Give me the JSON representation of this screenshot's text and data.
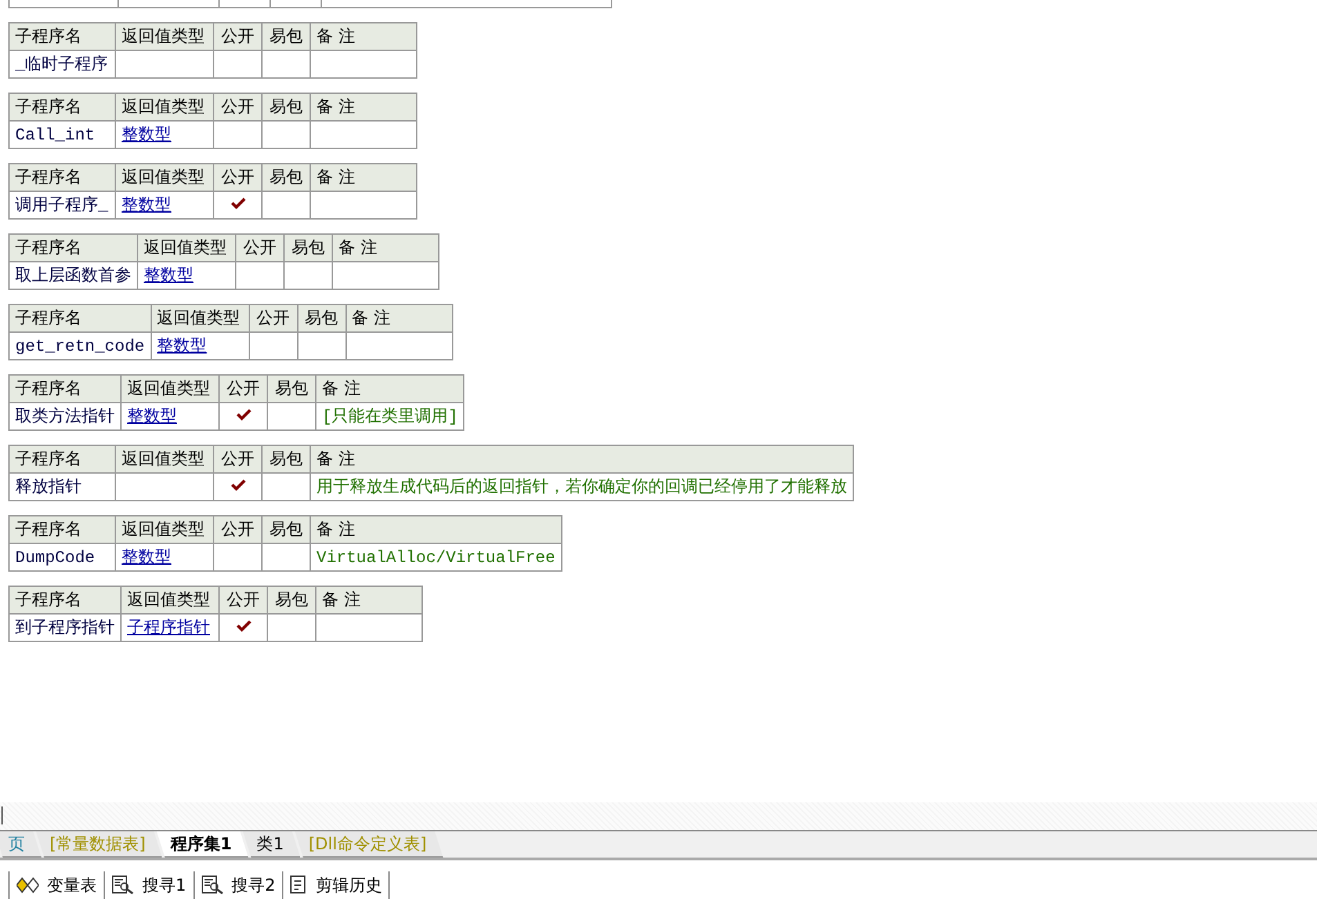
{
  "tables": [
    {
      "columns": [
        "子程序名",
        "返回值类型",
        "公开",
        "易包",
        "备 注"
      ],
      "row": {
        "name": "_临时子程序",
        "public": false
      }
    },
    {
      "columns": [
        "子程序名",
        "返回值类型",
        "公开",
        "易包",
        "备 注"
      ],
      "row": {
        "name": "Call_int",
        "return_type": "整数型",
        "public": false
      }
    },
    {
      "columns": [
        "子程序名",
        "返回值类型",
        "公开",
        "易包",
        "备 注"
      ],
      "row": {
        "name": "调用子程序_",
        "return_type": "整数型",
        "public": true
      }
    },
    {
      "columns": [
        "子程序名",
        "返回值类型",
        "公开",
        "易包",
        "备 注"
      ],
      "row": {
        "name": "取上层函数首参",
        "return_type": "整数型",
        "public": false
      }
    },
    {
      "columns": [
        "子程序名",
        "返回值类型",
        "公开",
        "易包",
        "备 注"
      ],
      "row": {
        "name": "get_retn_code",
        "return_type": "整数型",
        "public": false
      }
    },
    {
      "columns": [
        "子程序名",
        "返回值类型",
        "公开",
        "易包",
        "备 注"
      ],
      "row": {
        "name": "取类方法指针",
        "return_type": "整数型",
        "public": true,
        "notes": "[只能在类里调用]"
      }
    },
    {
      "columns": [
        "子程序名",
        "返回值类型",
        "公开",
        "易包",
        "备 注"
      ],
      "row": {
        "name": "释放指针",
        "public": true,
        "notes": "用于释放生成代码后的返回指针，若你确定你的回调已经停用了才能释放"
      }
    },
    {
      "columns": [
        "子程序名",
        "返回值类型",
        "公开",
        "易包",
        "备 注"
      ],
      "row": {
        "name": "DumpCode",
        "return_type": "整数型",
        "public": false,
        "notes": "VirtualAlloc/VirtualFree"
      }
    },
    {
      "columns": [
        "子程序名",
        "返回值类型",
        "公开",
        "易包",
        "备 注"
      ],
      "row": {
        "name": "到子程序指针",
        "return_type": "子程序指针",
        "public": true
      }
    }
  ],
  "tabs": [
    {
      "label": "页",
      "selected": false,
      "color": "#2080a0"
    },
    {
      "label": "[常量数据表]",
      "selected": false,
      "color": "#a09000"
    },
    {
      "label": "程序集1",
      "selected": true,
      "color": "#000000"
    },
    {
      "label": "类1",
      "selected": false,
      "color": "#000000"
    },
    {
      "label": "[Dll命令定义表]",
      "selected": false,
      "color": "#a09000"
    }
  ],
  "toolbar": [
    {
      "label": "变量表",
      "kind": "variables"
    },
    {
      "label": "搜寻1",
      "kind": "search"
    },
    {
      "label": "搜寻2",
      "kind": "search"
    },
    {
      "label": "剪辑历史",
      "kind": "history"
    }
  ]
}
